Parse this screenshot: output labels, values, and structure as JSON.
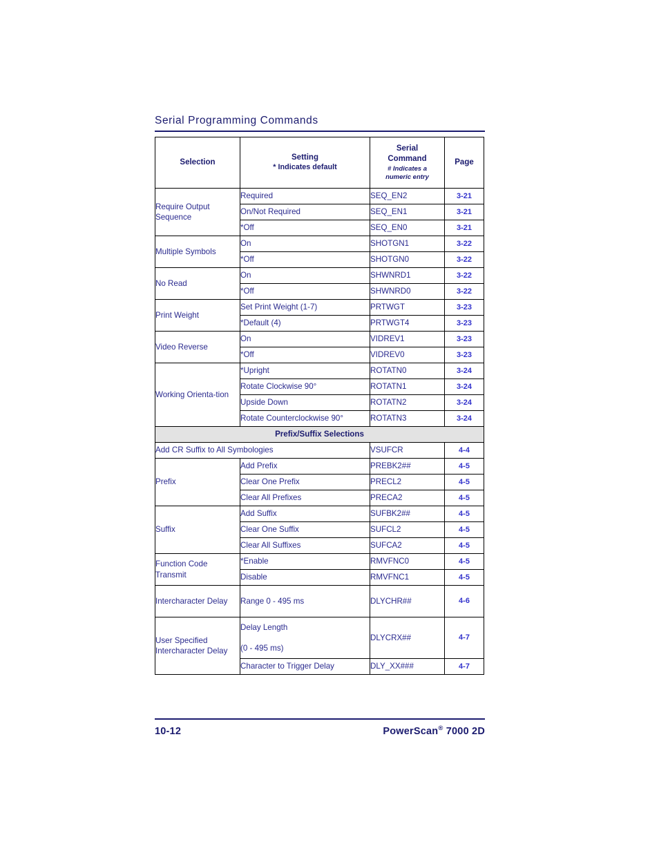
{
  "running_head": {
    "title": "Serial Programming Commands"
  },
  "table": {
    "headers": {
      "selection": "Selection",
      "setting_line1": "Setting",
      "setting_line2": "* Indicates default",
      "command_line1": "Serial",
      "command_line2": "Command",
      "command_note_line1": "# Indicates a",
      "command_note_line2": "numeric entry",
      "page": "Page"
    },
    "section_heading": "Prefix/Suffix Selections",
    "groups": [
      {
        "selection": "Require Output Sequence",
        "rows": [
          {
            "setting": "Required",
            "command": "SEQ_EN2",
            "page": "3-21"
          },
          {
            "setting": "On/Not Required",
            "command": "SEQ_EN1",
            "page": "3-21"
          },
          {
            "setting": "*Off",
            "command": "SEQ_EN0",
            "page": "3-21"
          }
        ]
      },
      {
        "selection": "Multiple Symbols",
        "rows": [
          {
            "setting": "On",
            "command": "SHOTGN1",
            "page": "3-22"
          },
          {
            "setting": "*Off",
            "command": "SHOTGN0",
            "page": "3-22"
          }
        ]
      },
      {
        "selection": "No Read",
        "rows": [
          {
            "setting": "On",
            "command": "SHWNRD1",
            "page": "3-22"
          },
          {
            "setting": "*Off",
            "command": "SHWNRD0",
            "page": "3-22"
          }
        ]
      },
      {
        "selection": "Print Weight",
        "rows": [
          {
            "setting": "Set Print Weight (1-7)",
            "command": "PRTWGT",
            "page": "3-23"
          },
          {
            "setting": "*Default (4)",
            "command": "PRTWGT4",
            "page": "3-23"
          }
        ]
      },
      {
        "selection": "Video Reverse",
        "rows": [
          {
            "setting": "On",
            "command": "VIDREV1",
            "page": "3-23"
          },
          {
            "setting": "*Off",
            "command": "VIDREV0",
            "page": "3-23"
          }
        ]
      },
      {
        "selection": "Working Orienta-tion",
        "rows": [
          {
            "setting": "*Upright",
            "command": "ROTATN0",
            "page": "3-24"
          },
          {
            "setting": "Rotate Clockwise 90°",
            "command": "ROTATN1",
            "page": "3-24"
          },
          {
            "setting": "Upside Down",
            "command": "ROTATN2",
            "page": "3-24"
          },
          {
            "setting": "Rotate Counterclockwise 90°",
            "command": "ROTATN3",
            "page": "3-24"
          }
        ]
      }
    ],
    "add_cr_row": {
      "label": "Add CR Suffix to All Symbologies",
      "command": "VSUFCR",
      "page": "4-4"
    },
    "groups2": [
      {
        "selection": "Prefix",
        "rows": [
          {
            "setting": "Add Prefix",
            "command": "PREBK2##",
            "page": "4-5"
          },
          {
            "setting": "Clear One Prefix",
            "command": "PRECL2",
            "page": "4-5"
          },
          {
            "setting": "Clear All Prefixes",
            "command": "PRECA2",
            "page": "4-5"
          }
        ]
      },
      {
        "selection": "Suffix",
        "rows": [
          {
            "setting": "Add Suffix",
            "command": "SUFBK2##",
            "page": "4-5"
          },
          {
            "setting": "Clear One Suffix",
            "command": "SUFCL2",
            "page": "4-5"
          },
          {
            "setting": "Clear All Suffixes",
            "command": "SUFCA2",
            "page": "4-5"
          }
        ]
      },
      {
        "selection": "Function Code Transmit",
        "rows": [
          {
            "setting": "*Enable",
            "command": "RMVFNC0",
            "page": "4-5"
          },
          {
            "setting": "Disable",
            "command": "RMVFNC1",
            "page": "4-5"
          }
        ]
      },
      {
        "selection": "Intercharacter Delay",
        "rows": [
          {
            "setting": "Range 0 - 495 ms",
            "command": "DLYCHR##",
            "page": "4-6"
          }
        ]
      }
    ],
    "user_specified": {
      "selection": "User Specified Intercharacter Delay",
      "delay_length_line1": "Delay Length",
      "delay_length_line2": "(0 - 495 ms)",
      "delay_command": "DLYCRX##",
      "delay_page": "4-7",
      "trigger_setting": "Character to Trigger Delay",
      "trigger_command": "DLY_XX###",
      "trigger_page": "4-7"
    }
  },
  "footer": {
    "page_number": "10-12",
    "product_name": "PowerScan",
    "product_mark": "®",
    "product_model": " 7000 2D"
  },
  "colors": {
    "heading_navy": "#1b1b6f",
    "body_blue": "#2a2a8e",
    "page_link_blue": "#3333cc",
    "section_shade": "#e3e3e3",
    "border": "#000000"
  }
}
